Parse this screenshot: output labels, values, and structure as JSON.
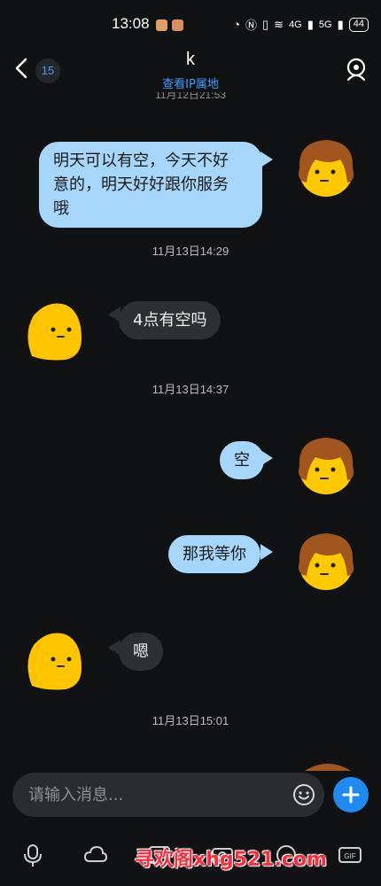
{
  "status_bar": {
    "time": "13:08",
    "battery": "44",
    "network_4g": "4G",
    "network_5g": "5G"
  },
  "header": {
    "title": "k",
    "ip_link": "查看IP属地",
    "unread_count": "15",
    "partial_timestamp": "11月12日21:53"
  },
  "messages": [
    {
      "sender": "me",
      "text": "明天可以有空，今天不好意的，明天好好跟你服务哦"
    },
    {
      "timestamp": "11月13日14:29"
    },
    {
      "sender": "them",
      "text": "4点有空吗"
    },
    {
      "timestamp": "11月13日14:37"
    },
    {
      "sender": "me",
      "text": "空"
    },
    {
      "sender": "me",
      "text": "那我等你"
    },
    {
      "sender": "them",
      "text": "嗯"
    },
    {
      "timestamp": "11月13日15:01"
    }
  ],
  "chat": {
    "m1_line1": "明天可以有空，今天不好",
    "m1_line2": "意的，明天好好跟你服务",
    "m1_line3": "哦",
    "ts1": "11月13日14:29",
    "m2": "4点有空吗",
    "ts2": "11月13日14:37",
    "m3": "空",
    "m4": "那我等你",
    "m5": "嗯",
    "ts3": "11月13日15:01"
  },
  "input": {
    "placeholder": "请输入消息..."
  },
  "toolbar": {
    "icons": [
      "microphone-icon",
      "cloud-icon",
      "image-icon",
      "camera-icon",
      "red-packet-icon",
      "gif-icon"
    ]
  },
  "watermark": "寻欢阁xhg521.com",
  "colors": {
    "background": "#111214",
    "my_bubble": "#a6d7fb",
    "their_bubble": "#2d2f33",
    "accent": "#1f8af0",
    "link": "#3a9cff",
    "watermark": "#ff2a3a"
  }
}
